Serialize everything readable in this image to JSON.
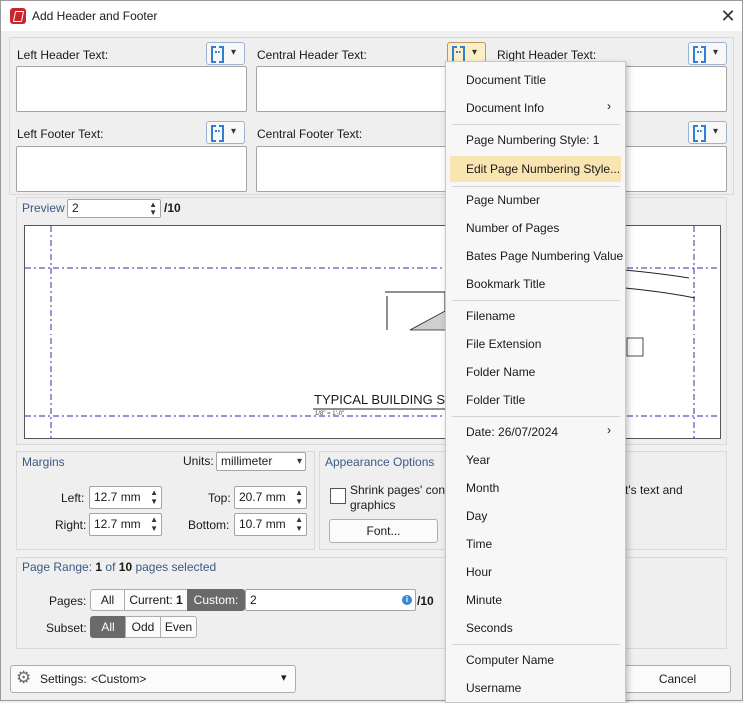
{
  "window": {
    "title": "Add Header and Footer"
  },
  "fields": {
    "left_header": "Left Header Text:",
    "central_header": "Central Header Text:",
    "right_header": "Right Header Text:",
    "left_footer": "Left Footer Text:",
    "central_footer": "Central Footer Text:"
  },
  "preview": {
    "label": "Preview",
    "page_value": "2",
    "page_total": "/10",
    "drawing_text": "TYPICAL BUILDING SE",
    "drawing_scale": "1/8\" = 1'-0\""
  },
  "margins": {
    "section": "Margins",
    "units_label": "Units:",
    "units_value": "millimeter",
    "left_label": "Left:",
    "left_value": "12.7 mm",
    "right_label": "Right:",
    "right_value": "12.7 mm",
    "top_label": "Top:",
    "top_value": "20.7 mm",
    "bottom_label": "Bottom:",
    "bottom_value": "10.7 mm"
  },
  "appearance": {
    "section": "Appearance Options",
    "shrink_line1": "Shrink pages' cont",
    "shrink_line2": "graphics",
    "font_button": "Font...",
    "right_text": "t's text and"
  },
  "page_range": {
    "heading_prefix": "Page Range: ",
    "selected_count": "1",
    "of": " of ",
    "total": "10",
    "suffix": " pages selected",
    "pages_label": "Pages:",
    "all": "All",
    "current_prefix": "Current: ",
    "current_value": "1",
    "custom": "Custom:",
    "custom_value": "2",
    "custom_total": "/10",
    "subset_label": "Subset:",
    "subset_all": "All",
    "subset_odd": "Odd",
    "subset_even": "Even"
  },
  "footer": {
    "settings_label": "Settings:",
    "settings_value": "<Custom>",
    "cancel": "Cancel"
  },
  "menu": {
    "items": [
      {
        "label": "Document Title",
        "submenu": false
      },
      {
        "label": "Document Info",
        "submenu": true
      },
      {
        "label": "Page Numbering Style: 1",
        "submenu": false
      },
      {
        "label": "Edit Page Numbering Style...",
        "submenu": false,
        "highlighted": true
      },
      {
        "label": "Page Number",
        "submenu": false
      },
      {
        "label": "Number of Pages",
        "submenu": false
      },
      {
        "label": "Bates Page Numbering Value",
        "submenu": false
      },
      {
        "label": "Bookmark Title",
        "submenu": false
      },
      {
        "label": "Filename",
        "submenu": false
      },
      {
        "label": "File Extension",
        "submenu": false
      },
      {
        "label": "Folder Name",
        "submenu": false
      },
      {
        "label": "Folder Title",
        "submenu": false
      },
      {
        "label": "Date: 26/07/2024",
        "submenu": true
      },
      {
        "label": "Year",
        "submenu": false
      },
      {
        "label": "Month",
        "submenu": false
      },
      {
        "label": "Day",
        "submenu": false
      },
      {
        "label": "Time",
        "submenu": false
      },
      {
        "label": "Hour",
        "submenu": false
      },
      {
        "label": "Minute",
        "submenu": false
      },
      {
        "label": "Seconds",
        "submenu": false
      },
      {
        "label": "Computer Name",
        "submenu": false
      },
      {
        "label": "Username",
        "submenu": false
      }
    ],
    "submenu_glyph": "›"
  },
  "icons": {
    "app": "pdf-editor-icon",
    "close": "close-icon",
    "macro": "insert-macro-icon",
    "settings": "gear-icon",
    "info": "info-icon"
  },
  "colors": {
    "accent_blue": "#2f7fd6",
    "highlight": "#f9e5b1",
    "guide_line": "#2b2bb0"
  }
}
